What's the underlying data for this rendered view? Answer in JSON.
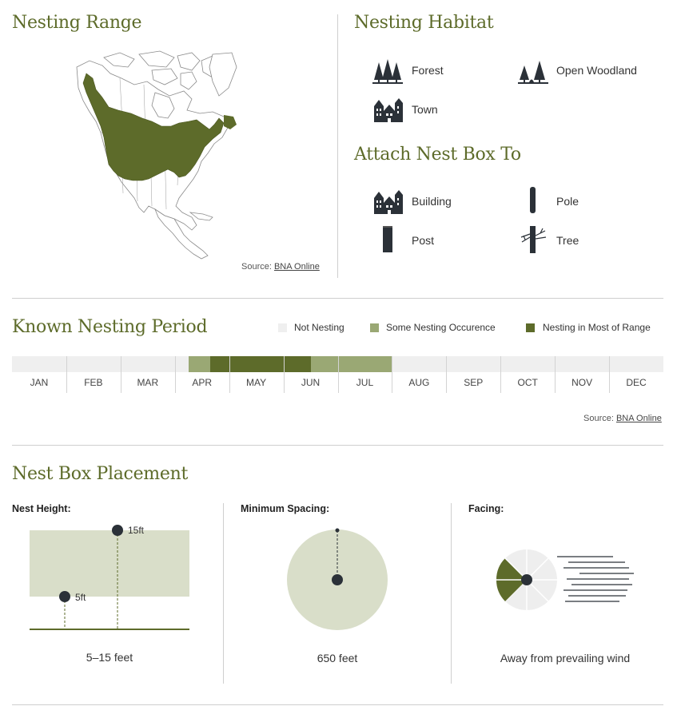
{
  "colors": {
    "accent_dark": "#5d6b2a",
    "accent_light": "#9aa874",
    "not_nesting": "#efefef",
    "box_fill": "#d9dec9",
    "icon": "#2b3138"
  },
  "nesting_range": {
    "title": "Nesting Range",
    "source_prefix": "Source: ",
    "source_link": "BNA Online"
  },
  "nesting_habitat": {
    "title": "Nesting Habitat",
    "items": [
      {
        "label": "Forest",
        "icon": "forest-icon"
      },
      {
        "label": "Open Woodland",
        "icon": "open-woodland-icon"
      },
      {
        "label": "Town",
        "icon": "town-icon"
      }
    ]
  },
  "attach_nest_box": {
    "title": "Attach Nest Box To",
    "items": [
      {
        "label": "Building",
        "icon": "building-icon"
      },
      {
        "label": "Pole",
        "icon": "pole-icon"
      },
      {
        "label": "Post",
        "icon": "post-icon"
      },
      {
        "label": "Tree",
        "icon": "tree-icon"
      }
    ]
  },
  "nesting_period": {
    "title": "Known Nesting Period",
    "legend": {
      "not_nesting": "Not Nesting",
      "some": "Some Nesting Occurence",
      "most": "Nesting in Most of Range"
    },
    "months": [
      "JAN",
      "FEB",
      "MAR",
      "APR",
      "MAY",
      "JUN",
      "JUL",
      "AUG",
      "SEP",
      "OCT",
      "NOV",
      "DEC"
    ],
    "segments": [
      {
        "start_month": 3.25,
        "end_month": 3.65,
        "level": "some"
      },
      {
        "start_month": 3.65,
        "end_month": 5.5,
        "level": "most"
      },
      {
        "start_month": 5.5,
        "end_month": 7.0,
        "level": "some"
      }
    ],
    "source_prefix": "Source: ",
    "source_link": "BNA Online"
  },
  "placement": {
    "title": "Nest Box Placement",
    "height": {
      "label": "Nest Height:",
      "low": "5ft",
      "high": "15ft",
      "caption": "5–15 feet"
    },
    "spacing": {
      "label": "Minimum Spacing:",
      "caption": "650 feet"
    },
    "facing": {
      "label": "Facing:",
      "caption": "Away from prevailing wind"
    }
  }
}
